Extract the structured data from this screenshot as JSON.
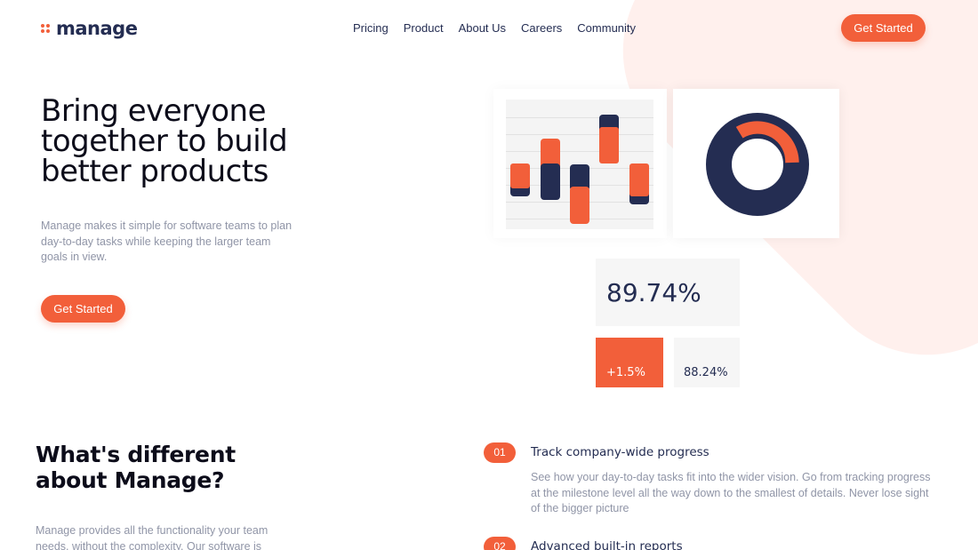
{
  "brand": {
    "name": "manage",
    "accent": "#f25f3a",
    "navy": "#242d52"
  },
  "nav": [
    "Pricing",
    "Product",
    "About Us",
    "Careers",
    "Community"
  ],
  "header_cta": "Get Started",
  "hero": {
    "title": "Bring everyone together to build better products",
    "description": "Manage makes it simple for software teams to plan day-to-day tasks while keeping the larger team goals in view.",
    "cta": "Get Started"
  },
  "stats": {
    "main": "89.74%",
    "change": "+1.5%",
    "secondary": "88.24%"
  },
  "section": {
    "title": "What's different about Manage?",
    "description": "Manage provides all the functionality your team needs, without the complexity. Our software is"
  },
  "features": [
    {
      "number": "01",
      "title": "Track company-wide progress",
      "description": "See how your day-to-day tasks fit into the wider vision. Go from tracking progress at the milestone level all the way down to the smallest of details. Never lose sight of the bigger picture"
    },
    {
      "number": "02",
      "title": "Advanced built-in reports",
      "description": ""
    }
  ]
}
